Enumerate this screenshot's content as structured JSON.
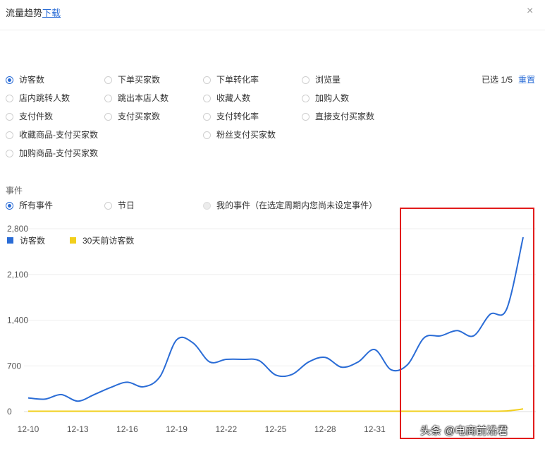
{
  "header": {
    "title": "流量趋势",
    "download_label": "下载",
    "close_icon": "×"
  },
  "metrics": {
    "selected_count": "已选 1/5",
    "reset_label": "重置",
    "options": [
      {
        "label": "访客数",
        "checked": true
      },
      {
        "label": "下单买家数",
        "checked": false
      },
      {
        "label": "下单转化率",
        "checked": false
      },
      {
        "label": "浏览量",
        "checked": false
      },
      {
        "label": "店内跳转人数",
        "checked": false
      },
      {
        "label": "跳出本店人数",
        "checked": false
      },
      {
        "label": "收藏人数",
        "checked": false
      },
      {
        "label": "加购人数",
        "checked": false
      },
      {
        "label": "支付件数",
        "checked": false
      },
      {
        "label": "支付买家数",
        "checked": false
      },
      {
        "label": "支付转化率",
        "checked": false
      },
      {
        "label": "直接支付买家数",
        "checked": false
      },
      {
        "label": "收藏商品-支付买家数",
        "checked": false
      },
      {
        "label": "粉丝支付买家数",
        "checked": false
      },
      {
        "label": "加购商品-支付买家数",
        "checked": false
      }
    ]
  },
  "events": {
    "label": "事件",
    "options": [
      {
        "label": "所有事件",
        "checked": true
      },
      {
        "label": "节日",
        "checked": false
      },
      {
        "label": "我的事件（在选定周期内您尚未设定事件）",
        "checked": false,
        "disabled": true
      }
    ]
  },
  "chart_data": {
    "type": "line",
    "ylim": [
      0,
      2800
    ],
    "yticks": [
      "0",
      "700",
      "1,400",
      "2,100",
      "2,800"
    ],
    "xticks": [
      "12-10",
      "12-13",
      "12-16",
      "12-19",
      "12-22",
      "12-25",
      "12-28",
      "12-31"
    ],
    "legend_placement": "top-left",
    "series": [
      {
        "name": "访客数",
        "color": "#2a6cd6",
        "values": [
          210,
          190,
          260,
          160,
          260,
          370,
          450,
          380,
          540,
          1100,
          1050,
          760,
          800,
          800,
          780,
          560,
          570,
          760,
          830,
          680,
          760,
          950,
          640,
          720,
          1130,
          1160,
          1240,
          1160,
          1490,
          1570,
          2670
        ]
      },
      {
        "name": "30天前访客数",
        "color": "#f2cf1c",
        "values": [
          5,
          5,
          5,
          5,
          5,
          5,
          5,
          5,
          5,
          5,
          5,
          5,
          5,
          5,
          5,
          5,
          5,
          5,
          5,
          5,
          5,
          5,
          5,
          5,
          5,
          5,
          5,
          5,
          5,
          10,
          40
        ]
      }
    ]
  },
  "overlay": {
    "highlight_color": "#e21c1c"
  },
  "watermark": "头条 @电商前沿君"
}
